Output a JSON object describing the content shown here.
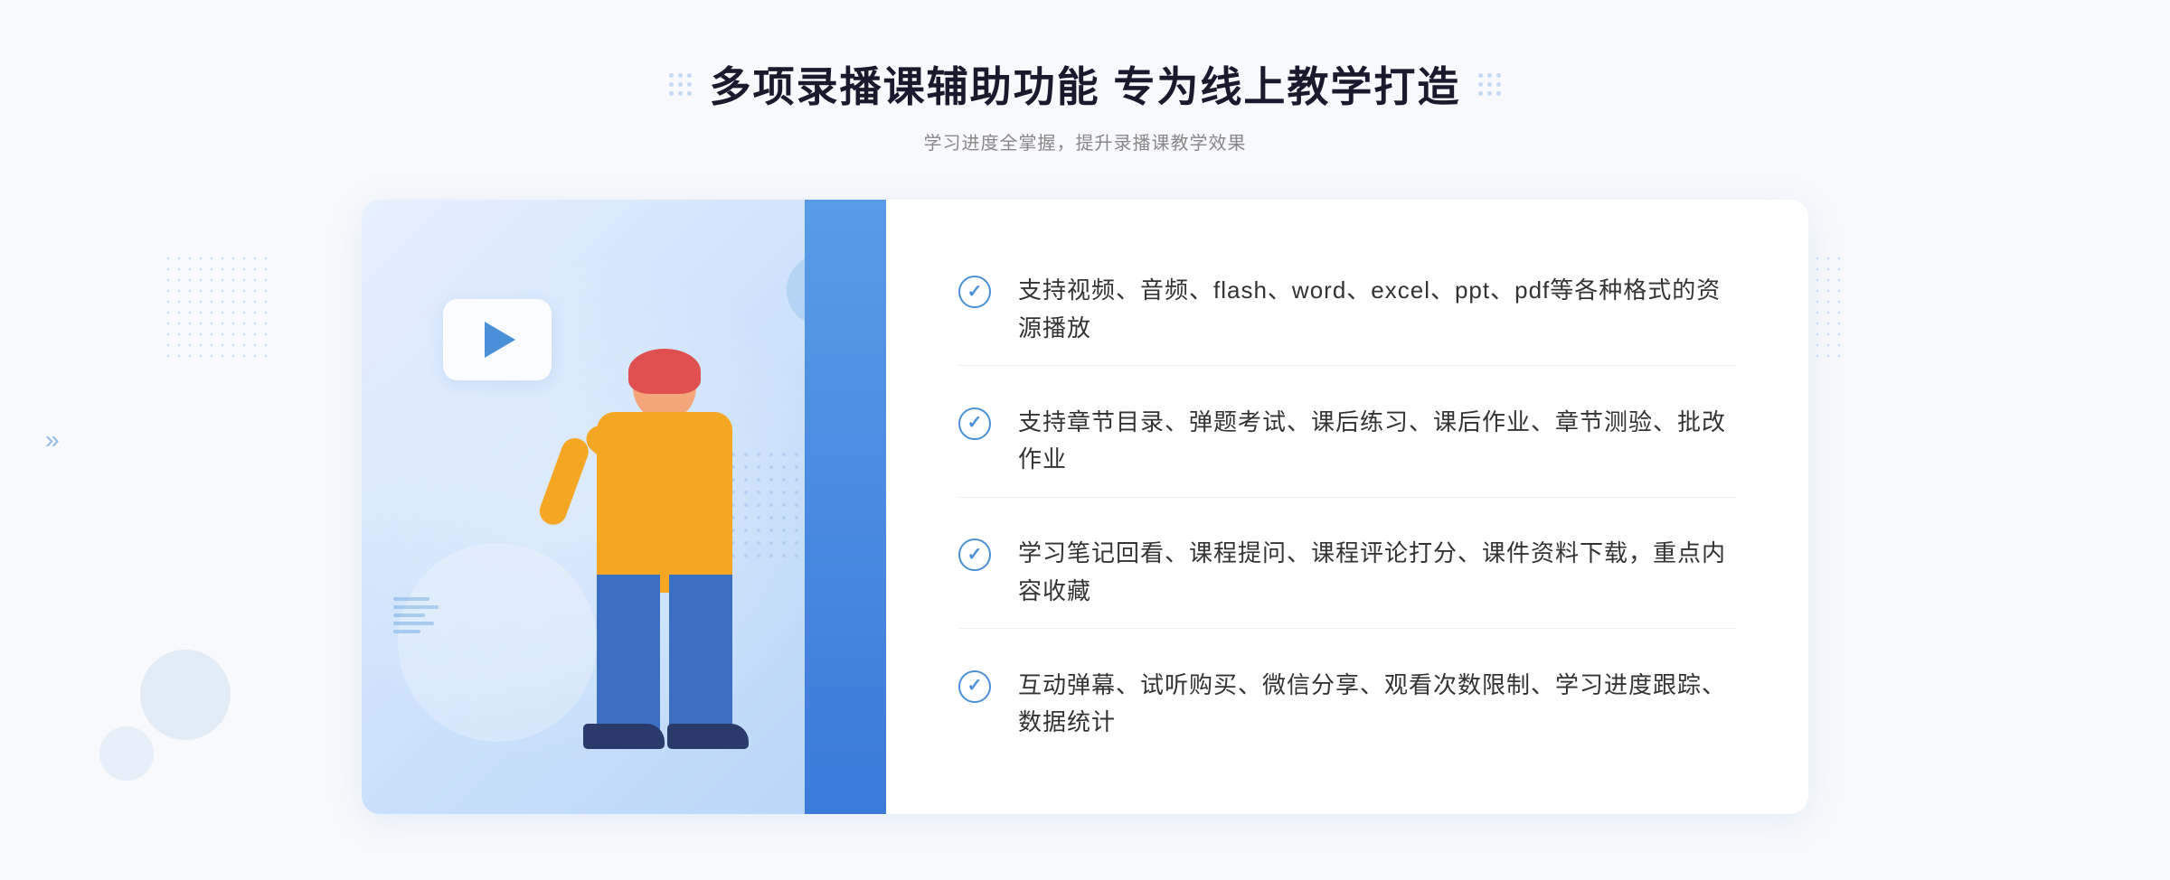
{
  "header": {
    "title": "多项录播课辅助功能 专为线上教学打造",
    "subtitle": "学习进度全掌握，提升录播课教学效果"
  },
  "features": [
    {
      "id": 1,
      "text": "支持视频、音频、flash、word、excel、ppt、pdf等各种格式的资源播放"
    },
    {
      "id": 2,
      "text": "支持章节目录、弹题考试、课后练习、课后作业、章节测验、批改作业"
    },
    {
      "id": 3,
      "text": "学习笔记回看、课程提问、课程评论打分、课件资料下载，重点内容收藏"
    },
    {
      "id": 4,
      "text": "互动弹幕、试听购买、微信分享、观看次数限制、学习进度跟踪、数据统计"
    }
  ],
  "chevrons": {
    "left": "»"
  },
  "colors": {
    "primary": "#4a90d9",
    "text_dark": "#1a1a2e",
    "text_gray": "#888888",
    "text_feature": "#333333",
    "bg_page": "#f8f9fc"
  }
}
